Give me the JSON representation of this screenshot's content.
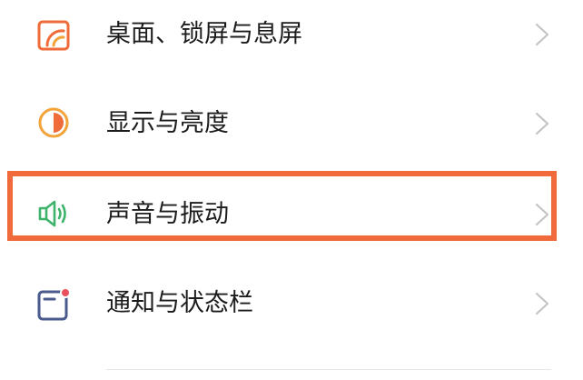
{
  "settings_list": {
    "items": [
      {
        "label": "桌面、锁屏与息屏",
        "icon": "wallpaper-icon"
      },
      {
        "label": "显示与亮度",
        "icon": "display-brightness-icon"
      },
      {
        "label": "声音与振动",
        "icon": "speaker-icon"
      },
      {
        "label": "通知与状态栏",
        "icon": "notification-icon"
      }
    ],
    "highlighted_item": "声音与振动"
  },
  "colors": {
    "wallpaper_icon": "#ef6c3a",
    "display_icon": "#f2a33a",
    "sound_icon": "#3fb36b",
    "notification_icon": "#4a5a8c",
    "notification_dot": "#e8505b",
    "chevron": "#c4c4c4",
    "highlight_border": "#f06a3c",
    "label_text": "#1c1c1c"
  }
}
